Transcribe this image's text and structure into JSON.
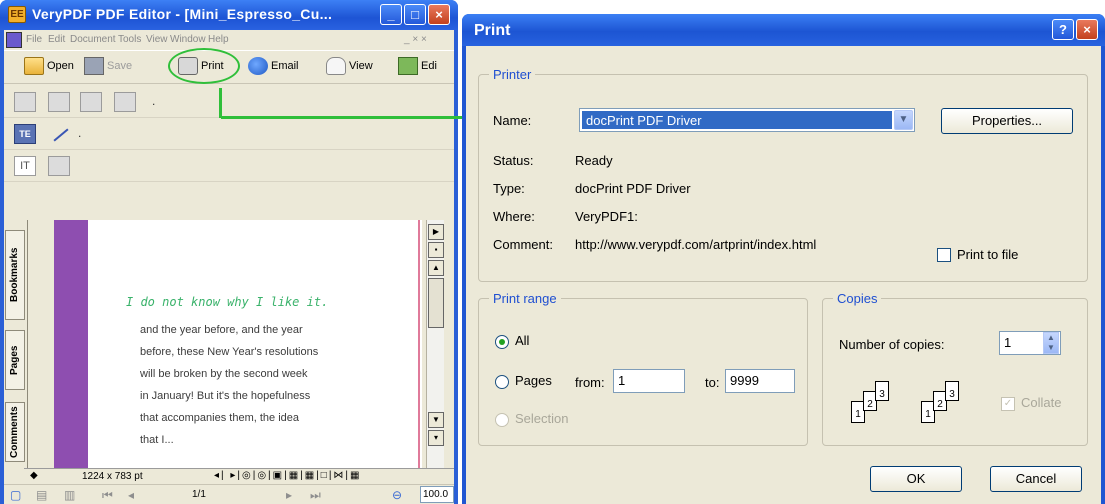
{
  "left_window": {
    "title": "VeryPDF PDF Editor - [Mini_Espresso_Cu...",
    "app_icon_text": "EE",
    "menu": [
      "File",
      "Edit",
      "Document",
      "Tools",
      "View",
      "Window",
      "Help"
    ],
    "menu_right": "_ × ×",
    "toolbar": {
      "open": "Open",
      "save": "Save",
      "print": "Print",
      "email": "Email",
      "view": "View",
      "edit": "Edi"
    },
    "tool_label_te": "TE",
    "tool_label_it": "IT",
    "side_tabs": [
      "Bookmarks",
      "Pages",
      "Comments"
    ],
    "page": {
      "quote": "I do not know why I like it.",
      "lines": [
        "and the year before, and the year",
        "before, these New Year's resolutions",
        "will be broken by the second week",
        "in January! But it's the hopefulness",
        "that accompanies them, the idea",
        "that I..."
      ]
    },
    "status": {
      "page_size": "1224 x 783 pt",
      "page_indicator": "1/1",
      "zoom": "100.0"
    }
  },
  "print_dialog": {
    "title": "Print",
    "printer_group": "Printer",
    "name_label": "Name:",
    "name_value": "docPrint PDF Driver",
    "properties_button": "Properties...",
    "status_label": "Status:",
    "status_value": "Ready",
    "type_label": "Type:",
    "type_value": "docPrint PDF Driver",
    "where_label": "Where:",
    "where_value": "VeryPDF1:",
    "comment_label": "Comment:",
    "comment_value": "http://www.verypdf.com/artprint/index.html",
    "print_to_file": "Print to file",
    "range_group": "Print range",
    "all_label": "All",
    "pages_label": "Pages",
    "from_label": "from:",
    "from_value": "1",
    "to_label": "to:",
    "to_value": "9999",
    "selection_label": "Selection",
    "copies_group": "Copies",
    "copies_label": "Number of copies:",
    "copies_value": "1",
    "collate_label": "Collate",
    "collate_pages": [
      "1",
      "2",
      "3"
    ],
    "ok_button": "OK",
    "cancel_button": "Cancel"
  },
  "colors": {
    "xp_blue": "#2a5fd6",
    "dialog_bg": "#ece9d8",
    "group_label": "#1f4fd1",
    "highlight": "#316ac5",
    "annotation_green": "#2fbf3a",
    "quote_green": "#39b26a",
    "purple_margin": "#8e4eb0"
  }
}
